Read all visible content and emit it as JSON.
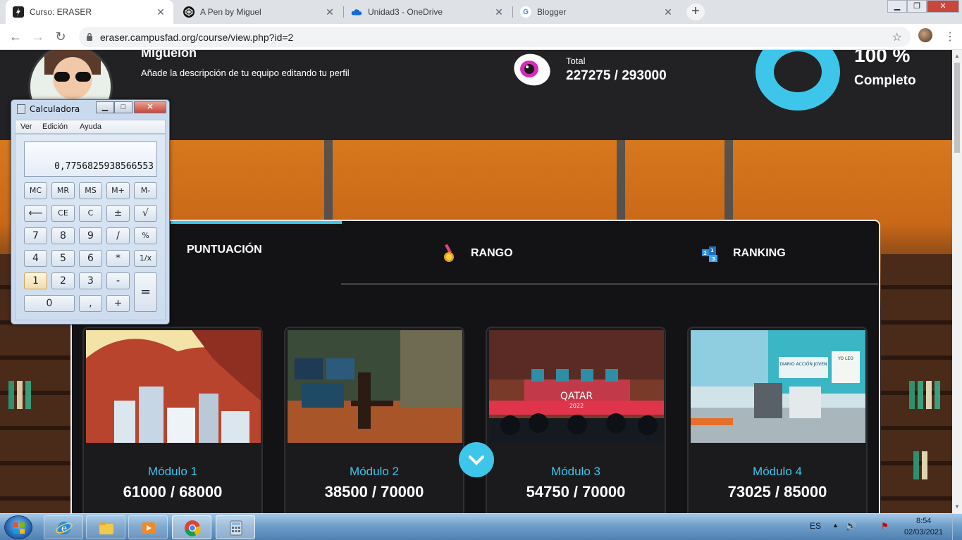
{
  "browser": {
    "tabs": [
      {
        "title": "Curso: ERASER",
        "active": true
      },
      {
        "title": "A Pen by Miguel",
        "active": false
      },
      {
        "title": "Unidad3 - OneDrive",
        "active": false
      },
      {
        "title": "Blogger",
        "active": false
      }
    ],
    "new_tab": "+",
    "url": "eraser.campusfad.org/course/view.php?id=2"
  },
  "profile": {
    "name": "Miguelon",
    "description": "Añade la descripción de tu equipo editando tu perfil"
  },
  "progress": {
    "total_label": "Total",
    "total_value": "227275 / 293000",
    "percent_text": "100 %",
    "percent_label": "Completo",
    "percent": 100
  },
  "stats_tabs": [
    {
      "label": "PUNTUACIÓN",
      "icon": "score-icon",
      "active": true
    },
    {
      "label": "RANGO",
      "icon": "medal-icon",
      "active": false
    },
    {
      "label": "RANKING",
      "icon": "ranking-cubes-icon",
      "active": false
    }
  ],
  "modules": [
    {
      "name": "Módulo 1",
      "score": "61000 / 68000"
    },
    {
      "name": "Módulo 2",
      "score": "38500 / 70000"
    },
    {
      "name": "Módulo 3",
      "score": "54750 / 70000"
    },
    {
      "name": "Módulo 4",
      "score": "73025 / 85000"
    }
  ],
  "module_images": {
    "qatar_text": "QATAR",
    "qatar_year": "2022",
    "newspaper_text": "DIARIO ACCIÓN JOVEN",
    "poster_text": "YO LEO"
  },
  "calculator": {
    "title": "Calculadora",
    "menu": [
      "Ver",
      "Edición",
      "Ayuda"
    ],
    "display": "0,7756825938566553",
    "keys": {
      "mc": "MC",
      "mr": "MR",
      "ms": "MS",
      "mplus": "M+",
      "mminus": "M-",
      "back": "⟵",
      "ce": "CE",
      "c": "C",
      "plusminus": "±",
      "sqrt": "√",
      "k7": "7",
      "k8": "8",
      "k9": "9",
      "div": "/",
      "pct": "%",
      "k4": "4",
      "k5": "5",
      "k6": "6",
      "mul": "*",
      "recip": "1/x",
      "k1": "1",
      "k2": "2",
      "k3": "3",
      "minus": "-",
      "equals": "=",
      "k0": "0",
      "comma": ",",
      "plus": "+"
    }
  },
  "taskbar": {
    "language": "ES",
    "time": "8:54",
    "date": "02/03/2021",
    "apps": [
      "start-orb",
      "internet-explorer",
      "windows-explorer",
      "media-player",
      "chrome",
      "calculator"
    ]
  },
  "colors": {
    "accent": "#3dc6ea",
    "panel_bg": "#131316",
    "header_bg": "#222224"
  }
}
